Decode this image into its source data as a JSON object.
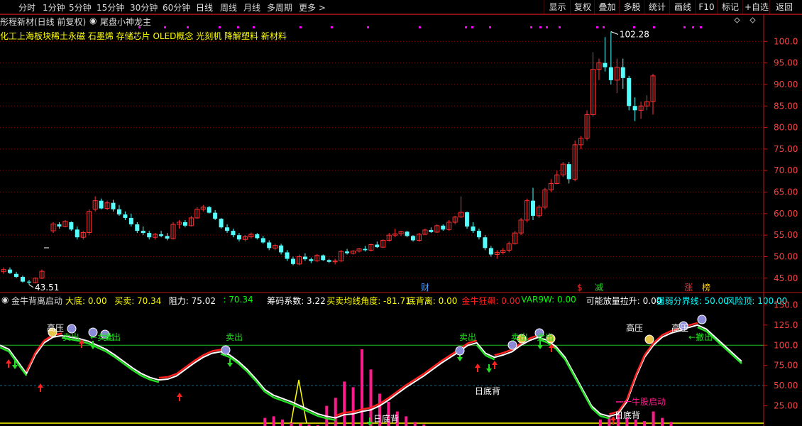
{
  "toolbar": {
    "timeframes": [
      "分时",
      "1分钟",
      "5分钟",
      "15分钟",
      "30分钟",
      "60分钟",
      "日线",
      "周线",
      "月线",
      "多周期",
      "更多 >"
    ],
    "buttons": [
      "显示",
      "复权",
      "叠加",
      "多股",
      "统计",
      "画线",
      "F10",
      "标记",
      "+自选",
      "返回"
    ]
  },
  "stock": {
    "name": "彤程新材(日线 前复权)",
    "indicator_name": "尾盘小神龙主",
    "concepts": "化工上海板块稀土永磁 石墨烯 存储芯片 OLED概念 光刻机 降解塑料 新材料"
  },
  "price_axis": {
    "ticks": [
      "100.0",
      "95.00",
      "90.00",
      "85.00",
      "80.00",
      "75.00",
      "70.00",
      "65.00",
      "60.00",
      "55.00",
      "50.00",
      "45.00"
    ]
  },
  "price_labels": {
    "high": "102.28",
    "low": "43.51"
  },
  "event_markers": {
    "cai": "财",
    "dollar": "$",
    "jian": "减",
    "zhang": "涨",
    "lou": "榜"
  },
  "indicator_bar": {
    "name": "金牛背离启动",
    "items": [
      {
        "label": "大底:",
        "value": "0.00",
        "color": "#ffff00"
      },
      {
        "label": "买卖:",
        "value": "70.34",
        "color": "#ffff00"
      },
      {
        "label": "阻力:",
        "value": "75.02",
        "color": "#ffffff"
      },
      {
        "label": ":",
        "value": "70.34",
        "color": "#00ff00"
      },
      {
        "label": "筹码系数:",
        "value": "3.22",
        "color": "#ffffff"
      },
      {
        "label": "买卖均线角度:",
        "value": "-81.71",
        "color": "#ffff00"
      },
      {
        "label": "底背离:",
        "value": "0.00",
        "color": "#ffff00"
      },
      {
        "label": "金牛狂飙:",
        "value": "0.00",
        "color": "#ff2020"
      },
      {
        "label": "VAR9W:",
        "value": "0.00",
        "color": "#00ff00"
      },
      {
        "label": "可能放量拉升:",
        "value": "0.00",
        "color": "#ffffff"
      },
      {
        "label": "强弱分界线:",
        "value": "50.00",
        "color": "#00ffff"
      },
      {
        "label": "风险顶:",
        "value": "100.00",
        "color": "#00ffff"
      }
    ]
  },
  "indicator_axis": {
    "ticks": [
      "150.0",
      "125.0",
      "100.0",
      "75.00",
      "50.00",
      "25.00"
    ]
  },
  "indicator_labels": {
    "gaoya": "高压",
    "maichu": "卖出",
    "ridibei": "日底背",
    "yiniugu": "一牛股启动",
    "jinchu": "←撤出",
    "maichu_arrow": "←卖出"
  },
  "colors": {
    "up": "#ff3232",
    "down": "#54ffff",
    "grid": "#7a1010",
    "axis": "#c01818",
    "line_white": "#ffffff",
    "line_red": "#ff2020",
    "line_green": "#22dd22",
    "hist": "#ff1a8c"
  },
  "chart_data": {
    "type": "candlestick",
    "title": "彤程新材(日线 前复权)",
    "ylim": [
      42,
      105
    ],
    "high_label": 102.28,
    "low_label": 43.51,
    "ohlc": [
      [
        46.5,
        47.5,
        46.0,
        47.0
      ],
      [
        47.0,
        47.5,
        46.0,
        46.2
      ],
      [
        46.0,
        46.5,
        45.0,
        45.3
      ],
      [
        45.3,
        45.6,
        44.0,
        44.2
      ],
      [
        44.2,
        44.6,
        43.51,
        44.0
      ],
      [
        44.0,
        45.2,
        43.8,
        45.0
      ],
      [
        45.0,
        47.0,
        44.8,
        46.6
      ],
      [
        null,
        null,
        null,
        null
      ],
      [
        56.0,
        58.0,
        55.5,
        57.6
      ],
      [
        57.5,
        58.0,
        56.5,
        57.0
      ],
      [
        57.0,
        58.5,
        56.8,
        58.2
      ],
      [
        58.0,
        58.2,
        56.0,
        56.3
      ],
      [
        56.3,
        57.0,
        54.0,
        54.5
      ],
      [
        54.5,
        56.0,
        54.0,
        55.6
      ],
      [
        55.6,
        61.0,
        55.0,
        60.5
      ],
      [
        61.0,
        64.0,
        60.5,
        63.0
      ],
      [
        63.0,
        63.5,
        61.0,
        61.2
      ],
      [
        61.2,
        63.0,
        60.8,
        62.5
      ],
      [
        62.5,
        63.2,
        60.5,
        61.0
      ],
      [
        61.0,
        62.0,
        59.5,
        59.8
      ],
      [
        59.8,
        60.5,
        58.5,
        59.0
      ],
      [
        59.0,
        60.0,
        57.0,
        57.5
      ],
      [
        57.5,
        58.0,
        55.5,
        56.0
      ],
      [
        56.0,
        57.0,
        55.0,
        55.5
      ],
      [
        55.5,
        56.0,
        54.0,
        54.5
      ],
      [
        54.5,
        55.5,
        54.0,
        55.2
      ],
      [
        55.2,
        56.0,
        54.5,
        54.8
      ],
      [
        54.8,
        55.5,
        53.8,
        54.2
      ],
      [
        54.2,
        58.0,
        54.0,
        57.5
      ],
      [
        57.5,
        58.5,
        56.5,
        58.0
      ],
      [
        58.0,
        58.5,
        56.8,
        57.2
      ],
      [
        57.2,
        59.5,
        57.0,
        59.0
      ],
      [
        59.0,
        61.5,
        58.8,
        61.0
      ],
      [
        61.0,
        62.0,
        60.5,
        61.5
      ],
      [
        61.5,
        61.8,
        60.0,
        60.2
      ],
      [
        60.2,
        60.8,
        58.5,
        58.8
      ],
      [
        58.8,
        59.0,
        56.5,
        56.8
      ],
      [
        56.8,
        57.5,
        55.5,
        56.0
      ],
      [
        56.0,
        56.5,
        54.5,
        55.0
      ],
      [
        55.0,
        55.5,
        53.5,
        54.0
      ],
      [
        54.0,
        55.0,
        53.5,
        54.6
      ],
      [
        54.6,
        55.6,
        54.2,
        55.2
      ],
      [
        55.2,
        55.5,
        54.0,
        54.3
      ],
      [
        54.3,
        54.8,
        53.0,
        53.3
      ],
      [
        53.3,
        53.8,
        51.5,
        52.0
      ],
      [
        52.0,
        53.0,
        51.5,
        52.6
      ],
      [
        52.6,
        53.0,
        50.5,
        51.0
      ],
      [
        51.0,
        51.5,
        49.0,
        49.5
      ],
      [
        49.5,
        50.0,
        48.0,
        48.3
      ],
      [
        48.3,
        50.5,
        48.0,
        50.0
      ],
      [
        50.0,
        50.8,
        49.0,
        49.4
      ],
      [
        49.4,
        49.8,
        48.5,
        49.0
      ],
      [
        49.0,
        50.6,
        48.8,
        50.3
      ],
      [
        50.3,
        50.5,
        49.0,
        49.2
      ],
      [
        49.2,
        49.5,
        48.5,
        48.8
      ],
      [
        48.8,
        49.5,
        48.2,
        49.0
      ],
      [
        49.0,
        51.5,
        48.8,
        51.2
      ],
      [
        51.2,
        51.8,
        50.5,
        50.8
      ],
      [
        50.8,
        51.5,
        50.5,
        51.3
      ],
      [
        51.3,
        52.0,
        51.0,
        51.8
      ],
      [
        51.8,
        52.5,
        51.2,
        51.5
      ],
      [
        51.5,
        53.0,
        51.2,
        52.8
      ],
      [
        52.8,
        53.5,
        52.0,
        52.2
      ],
      [
        52.2,
        54.0,
        52.0,
        53.8
      ],
      [
        53.8,
        55.5,
        53.5,
        55.0
      ],
      [
        55.0,
        56.5,
        54.5,
        55.3
      ],
      [
        55.3,
        56.0,
        54.8,
        55.8
      ],
      [
        55.8,
        56.0,
        54.5,
        54.8
      ],
      [
        54.8,
        55.0,
        53.5,
        53.8
      ],
      [
        53.8,
        55.5,
        53.5,
        55.2
      ],
      [
        55.2,
        56.5,
        55.0,
        56.2
      ],
      [
        56.2,
        56.8,
        55.5,
        55.7
      ],
      [
        55.7,
        57.5,
        55.5,
        57.2
      ],
      [
        57.2,
        57.5,
        56.0,
        56.3
      ],
      [
        56.3,
        58.5,
        56.0,
        58.0
      ],
      [
        58.0,
        59.5,
        57.5,
        59.2
      ],
      [
        59.2,
        64.0,
        59.0,
        60.3
      ],
      [
        60.3,
        60.5,
        56.5,
        57.0
      ],
      [
        57.0,
        58.0,
        55.5,
        56.0
      ],
      [
        56.0,
        56.5,
        54.0,
        54.5
      ],
      [
        54.5,
        55.0,
        51.5,
        52.0
      ],
      [
        52.0,
        52.5,
        50.0,
        50.5
      ],
      [
        50.5,
        51.5,
        49.5,
        51.0
      ],
      [
        51.0,
        52.0,
        50.5,
        51.5
      ],
      [
        51.5,
        53.5,
        51.0,
        53.0
      ],
      [
        53.0,
        56.0,
        52.8,
        55.5
      ],
      [
        55.5,
        59.0,
        55.0,
        58.5
      ],
      [
        58.5,
        63.5,
        58.0,
        63.0
      ],
      [
        63.0,
        66.0,
        58.5,
        59.5
      ],
      [
        59.5,
        62.0,
        59.0,
        61.5
      ],
      [
        61.5,
        66.0,
        61.0,
        65.5
      ],
      [
        65.5,
        68.0,
        65.0,
        67.0
      ],
      [
        67.0,
        70.0,
        66.8,
        69.0
      ],
      [
        69.0,
        72.0,
        68.5,
        71.5
      ],
      [
        71.5,
        72.0,
        67.0,
        68.0
      ],
      [
        68.0,
        77.0,
        67.5,
        76.0
      ],
      [
        76.0,
        78.0,
        75.0,
        77.5
      ],
      [
        77.5,
        84.0,
        77.0,
        83.0
      ],
      [
        83.0,
        97.5,
        82.5,
        93.5
      ],
      [
        93.5,
        96.0,
        91.0,
        95.0
      ],
      [
        95.0,
        101.0,
        93.0,
        94.0
      ],
      [
        94.0,
        102.28,
        90.0,
        91.0
      ],
      [
        91.0,
        96.0,
        88.0,
        94.0
      ],
      [
        94.0,
        96.0,
        89.0,
        91.5
      ],
      [
        91.5,
        92.0,
        84.0,
        85.0
      ],
      [
        85.0,
        87.0,
        81.5,
        84.0
      ],
      [
        84.0,
        86.0,
        82.0,
        85.0
      ],
      [
        85.0,
        87.5,
        84.0,
        86.0
      ],
      [
        86.0,
        92.5,
        83.0,
        92.0
      ]
    ],
    "indicator": {
      "ylim": [
        0,
        160
      ],
      "reference_lines": [
        100,
        50
      ],
      "white_line": [
        100,
        95,
        80,
        65,
        88,
        103,
        110,
        112,
        110,
        108,
        105,
        100,
        95,
        88,
        80,
        72,
        65,
        60,
        57,
        58,
        62,
        70,
        78,
        85,
        90,
        92,
        88,
        80,
        70,
        58,
        45,
        38,
        34,
        30,
        25,
        20,
        15,
        12,
        10,
        14,
        15,
        18,
        20,
        25,
        32,
        40,
        48,
        55,
        62,
        70,
        78,
        85,
        92,
        100,
        103,
        90,
        85,
        88,
        92,
        100,
        106,
        110,
        106,
        98,
        85,
        65,
        45,
        25,
        15,
        12,
        15,
        30,
        60,
        85,
        100,
        110,
        115,
        118,
        122,
        125,
        120,
        110,
        100,
        90,
        80
      ],
      "histogram": [
        0,
        0,
        0,
        0,
        0,
        0,
        0,
        0,
        0,
        0,
        0,
        0,
        0,
        0,
        0,
        0,
        0,
        0,
        0,
        0,
        0,
        0,
        0,
        0,
        0,
        0,
        0,
        0,
        0,
        0,
        10,
        12,
        8,
        5,
        3,
        2,
        1,
        25,
        35,
        55,
        48,
        95,
        70,
        40,
        30,
        18,
        12,
        5,
        2,
        0,
        0,
        0,
        0,
        0,
        0,
        0,
        0,
        0,
        0,
        0,
        0,
        0,
        0,
        0,
        0,
        0,
        0,
        0,
        8,
        12,
        15,
        10,
        8,
        6,
        18,
        10,
        5,
        0,
        0,
        0,
        0,
        0,
        0,
        0,
        0
      ]
    }
  }
}
